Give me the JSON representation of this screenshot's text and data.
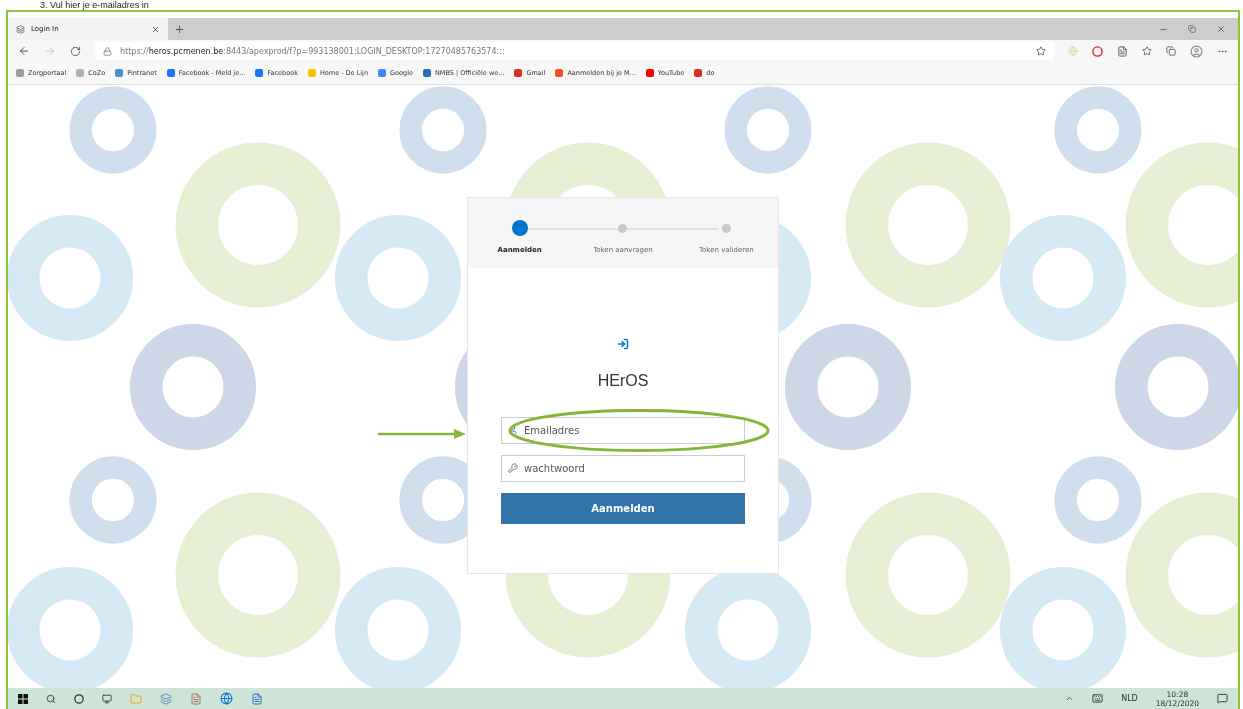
{
  "heading": "3.   Vul hier je e-mailadres in",
  "browser": {
    "tab": {
      "title": "Login In"
    },
    "url": "https://**heros.pcmenen.be**:8443/apexprod/f?p=993138001:LOGIN_DESKTOP:17270485763574:::",
    "bookmarks": [
      {
        "label": "Zorgportaal",
        "color": "#9e9e9e"
      },
      {
        "label": "CoZo",
        "color": "#b0b0b0"
      },
      {
        "label": "Pintranet",
        "color": "#4a90c8"
      },
      {
        "label": "Facebook - Meld je...",
        "color": "#1877f2"
      },
      {
        "label": "Facebook",
        "color": "#1877f2"
      },
      {
        "label": "Home - De Lijn",
        "color": "#f5c400"
      },
      {
        "label": "Google",
        "color": "#4285f4"
      },
      {
        "label": "NMBS | Officiële we...",
        "color": "#2a6ebb"
      },
      {
        "label": "Gmail",
        "color": "#d93025"
      },
      {
        "label": "Aanmelden bij je M...",
        "color": "#f25022"
      },
      {
        "label": "YouTube",
        "color": "#ff0000"
      },
      {
        "label": "do",
        "color": "#d93025"
      }
    ]
  },
  "login": {
    "steps": [
      {
        "label": "Aanmelden",
        "selected": true
      },
      {
        "label": "Token aanvragen",
        "selected": false
      },
      {
        "label": "Token valideren",
        "selected": false
      }
    ],
    "title": "HErOS",
    "email": {
      "placeholder": "Emailadres"
    },
    "password": {
      "placeholder": "wachtwoord"
    },
    "submit": "Aanmelden"
  },
  "taskbar": {
    "language": "NLD",
    "time": "10:28",
    "date": "18/12/2020"
  }
}
